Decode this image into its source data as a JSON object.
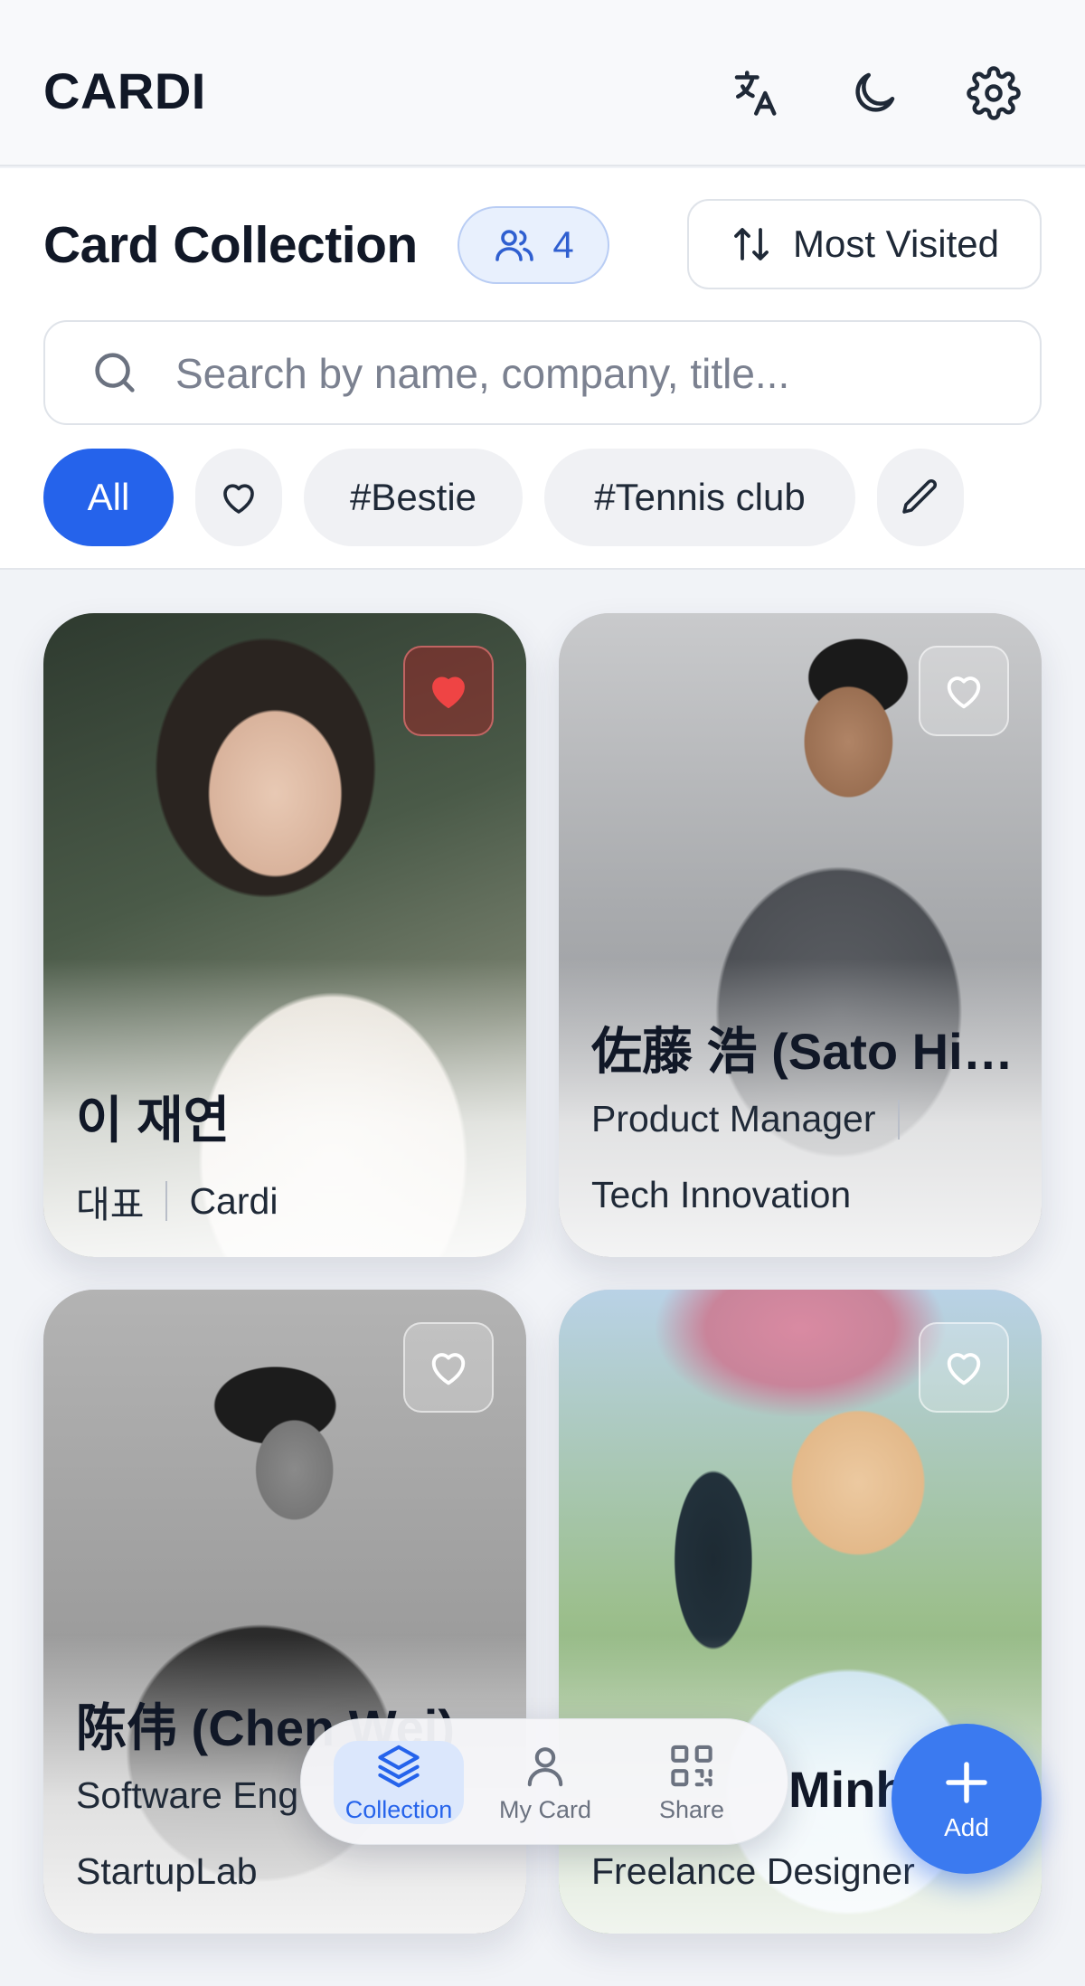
{
  "app": {
    "title": "CARDI"
  },
  "header": {
    "icons": [
      "translate-icon",
      "moon-icon",
      "gear-icon"
    ]
  },
  "collection": {
    "title": "Card Collection",
    "count": "4",
    "sort_label": "Most Visited",
    "search_placeholder": "Search by name, company, title...",
    "search_value": "",
    "filters": [
      {
        "label": "All",
        "active": true
      },
      {
        "label": "",
        "icon": "heart-icon"
      },
      {
        "label": "#Bestie"
      },
      {
        "label": "#Tennis club"
      },
      {
        "label": "",
        "icon": "pencil-icon"
      }
    ]
  },
  "cards": [
    {
      "name": "이 재연",
      "title": "대표",
      "company": "Cardi",
      "favorite": true
    },
    {
      "name": "佐藤 浩 (Sato Hir...",
      "title": "Product Manager",
      "company": "Tech Innovation",
      "favorite": false
    },
    {
      "name": "陈伟 (Chen Wei)",
      "title": "Software Eng",
      "company": "StartupLab",
      "favorite": false
    },
    {
      "name": "Minh",
      "title": "Freelance Designer",
      "company": "",
      "favorite": false
    }
  ],
  "nav": {
    "collection": "Collection",
    "my_card": "My Card",
    "share": "Share"
  },
  "fab": {
    "label": "Add"
  },
  "colors": {
    "accent": "#2563eb",
    "favorite": "#ef4444"
  }
}
